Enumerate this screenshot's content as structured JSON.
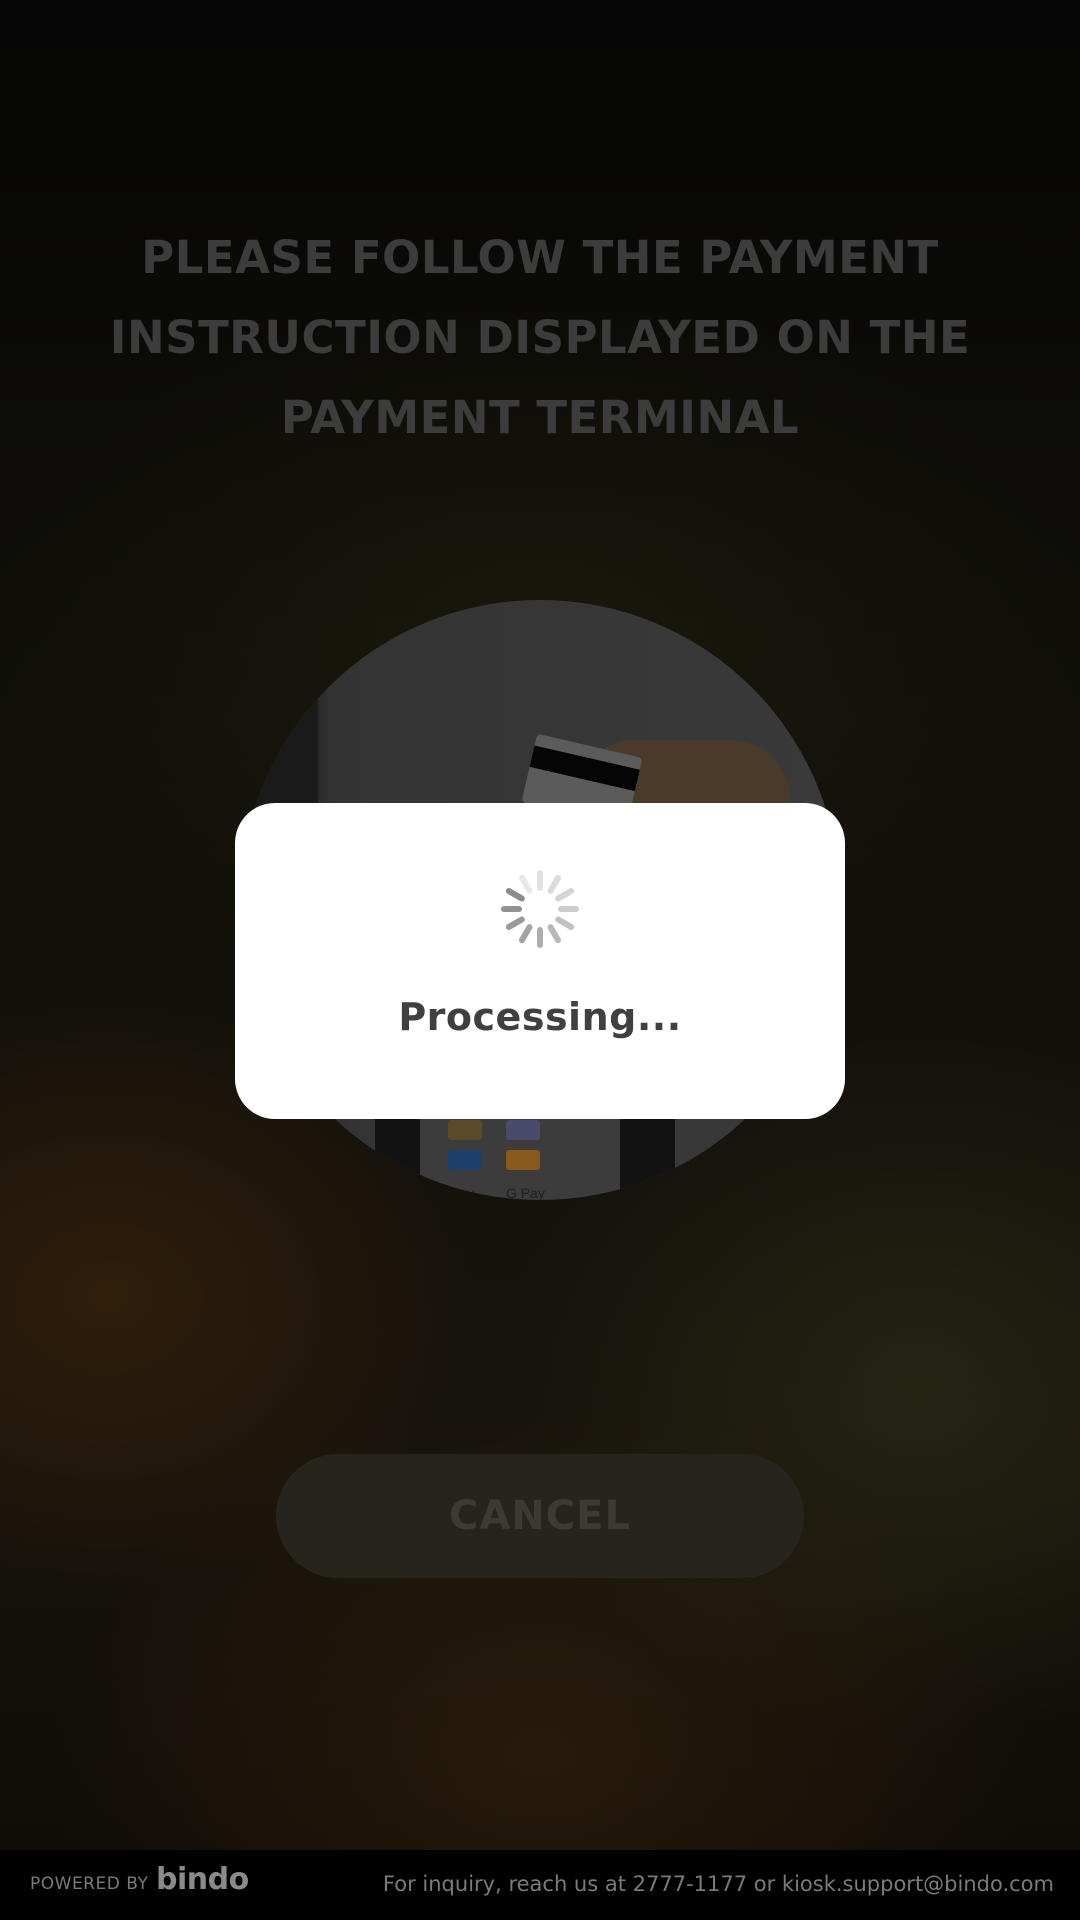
{
  "instruction": {
    "line1": "PLEASE FOLLOW THE PAYMENT",
    "line2": "INSTRUCTION DISPLAYED ON THE",
    "line3": "PAYMENT TERMINAL"
  },
  "terminal_art": {
    "wallet_labels": [
      "Pay",
      "G Pay"
    ]
  },
  "actions": {
    "cancel_label": "CANCEL"
  },
  "modal": {
    "status_text": "Processing...",
    "spinner_icon": "loading-spinner-icon"
  },
  "footer": {
    "powered_by": "POWERED BY",
    "brand": "bindo",
    "inquiry_text": "For inquiry, reach us at 2777-1177 or  kiosk.support@bindo.com"
  },
  "colors": {
    "modal_background": "#ffffff",
    "status_text": "#404040",
    "footer_background": "#000000"
  }
}
